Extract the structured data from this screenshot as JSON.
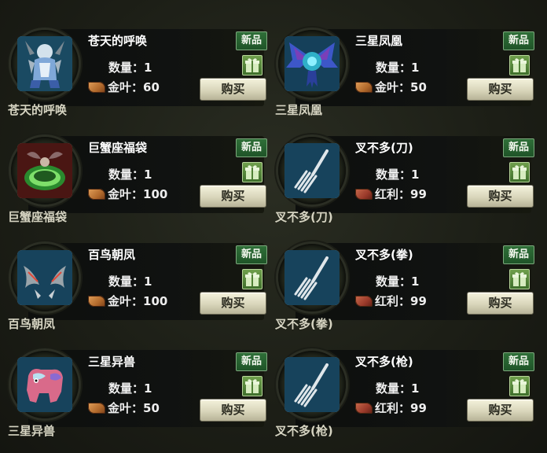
{
  "ui": {
    "new_badge": "新品",
    "buy_label": "购买",
    "qty_prefix": "数量："
  },
  "items": [
    {
      "title": "苍天的呼唤",
      "quantity": "1",
      "currency": "金叶",
      "price": "60",
      "icon": "armored-warrior-icon",
      "label": "苍天的呼唤"
    },
    {
      "title": "三星凤凰",
      "quantity": "1",
      "currency": "金叶",
      "price": "50",
      "icon": "blue-phoenix-icon",
      "label": "三星凤凰"
    },
    {
      "title": "巨蟹座福袋",
      "quantity": "1",
      "currency": "金叶",
      "price": "100",
      "icon": "cancer-lucky-bag-icon",
      "label": "巨蟹座福袋"
    },
    {
      "title": "叉不多(刀)",
      "quantity": "1",
      "currency": "红利",
      "price": "99",
      "icon": "fork-icon",
      "label": "叉不多(刀)"
    },
    {
      "title": "百鸟朝凤",
      "quantity": "1",
      "currency": "金叶",
      "price": "100",
      "icon": "bird-wings-icon",
      "label": "百鸟朝凤"
    },
    {
      "title": "叉不多(拳)",
      "quantity": "1",
      "currency": "红利",
      "price": "99",
      "icon": "fork-icon",
      "label": "叉不多(拳)"
    },
    {
      "title": "三星异兽",
      "quantity": "1",
      "currency": "金叶",
      "price": "50",
      "icon": "pink-beast-icon",
      "label": "三星异兽"
    },
    {
      "title": "叉不多(枪)",
      "quantity": "1",
      "currency": "红利",
      "price": "99",
      "icon": "fork-icon",
      "label": "叉不多(枪)"
    }
  ],
  "colors": {
    "badge_green": "#2f6f38",
    "gold_leaf": "#c98a45",
    "bonus_red": "#9a3a2a"
  }
}
